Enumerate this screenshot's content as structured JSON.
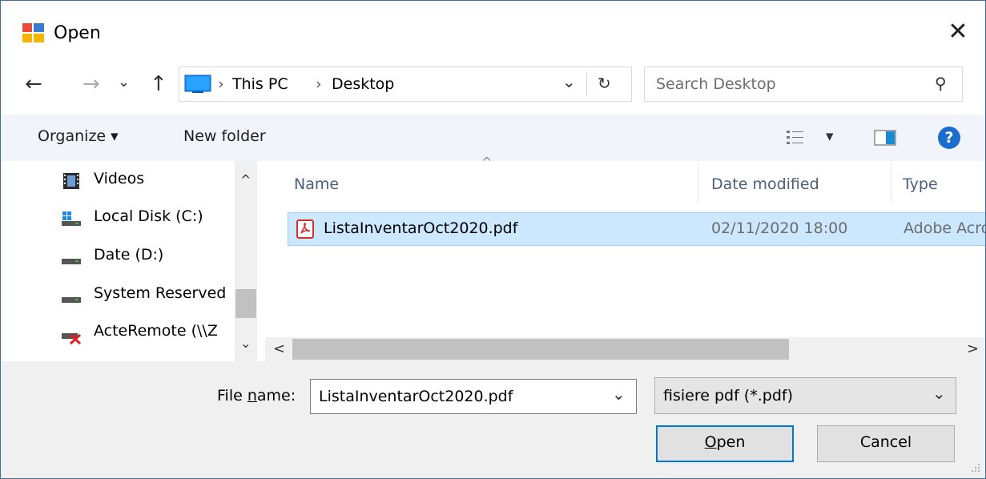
{
  "window": {
    "title": "Open",
    "close_glyph": "✕"
  },
  "nav": {
    "back_glyph": "←",
    "forward_glyph": "→",
    "recent_glyph": "⌄",
    "up_glyph": "↑",
    "breadcrumb": [
      "This PC",
      "Desktop"
    ],
    "crumb_sep": "›",
    "dropdown_glyph": "⌄",
    "refresh_glyph": "↻",
    "search_placeholder": "Search Desktop",
    "search_glyph": "⚲"
  },
  "toolbar": {
    "organize_label": "Organize ▾",
    "new_folder_label": "New folder",
    "view_dropdown_glyph": "▾",
    "help_glyph": "?"
  },
  "sidebar": {
    "items": [
      {
        "label": "Videos",
        "icon": "videos-icon"
      },
      {
        "label": "Local Disk (C:)",
        "icon": "local-disk-icon"
      },
      {
        "label": "Date (D:)",
        "icon": "drive-icon"
      },
      {
        "label": "System Reserved",
        "icon": "drive-icon"
      },
      {
        "label": "ActeRemote (\\\\Z",
        "icon": "network-drive-disconnected-icon"
      }
    ],
    "scroll_up_glyph": "^",
    "scroll_down_glyph": "⌄"
  },
  "file_list": {
    "sort_glyph": "^",
    "columns": [
      "Name",
      "Date modified",
      "Type"
    ],
    "rows": [
      {
        "name": "ListaInventarOct2020.pdf",
        "date": "02/11/2020 18:00",
        "type": "Adobe Acrobat Document",
        "selected": true
      }
    ],
    "scroll_left_glyph": "<",
    "scroll_right_glyph": ">"
  },
  "footer": {
    "file_name_label_pre": "File ",
    "file_name_label_u": "n",
    "file_name_label_post": "ame:",
    "file_name_value": "ListaInventarOct2020.pdf",
    "filter_value": "fisiere pdf (*.pdf)",
    "combo_glyph": "⌄",
    "open_u": "O",
    "open_rest": "pen",
    "cancel_label": "Cancel"
  },
  "colors": {
    "accent": "#0078d7",
    "selection": "#cce8ff",
    "toolbar_bg": "#f1f5fb"
  }
}
